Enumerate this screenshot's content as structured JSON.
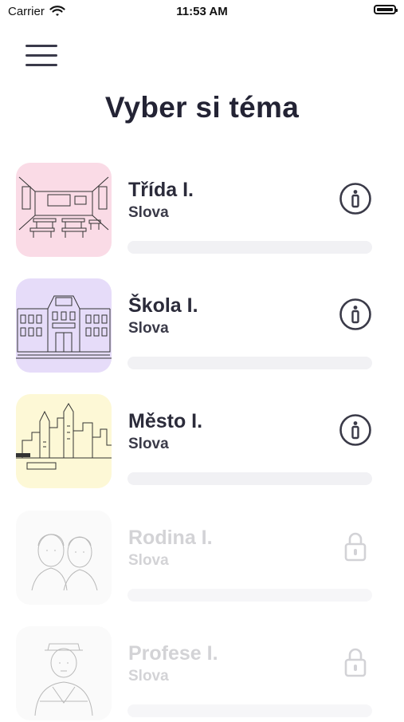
{
  "status_bar": {
    "carrier": "Carrier",
    "time": "11:53 AM"
  },
  "header": {
    "title": "Vyber si téma"
  },
  "topics": [
    {
      "title": "Třída I.",
      "subtitle": "Slova",
      "thumb_color": "#fadbe6",
      "icon": "info-icon",
      "locked": false,
      "progress": 0
    },
    {
      "title": "Škola I.",
      "subtitle": "Slova",
      "thumb_color": "#e6dcf9",
      "icon": "info-icon",
      "locked": false,
      "progress": 0
    },
    {
      "title": "Město I.",
      "subtitle": "Slova",
      "thumb_color": "#fdf8d6",
      "icon": "info-icon",
      "locked": false,
      "progress": 0
    },
    {
      "title": "Rodina I.",
      "subtitle": "Slova",
      "thumb_color": "#f4f4f4",
      "icon": "lock-icon",
      "locked": true,
      "progress": 0
    },
    {
      "title": "Profese I.",
      "subtitle": "Slova",
      "thumb_color": "#f4f4f4",
      "icon": "lock-icon",
      "locked": true,
      "progress": 0
    }
  ]
}
